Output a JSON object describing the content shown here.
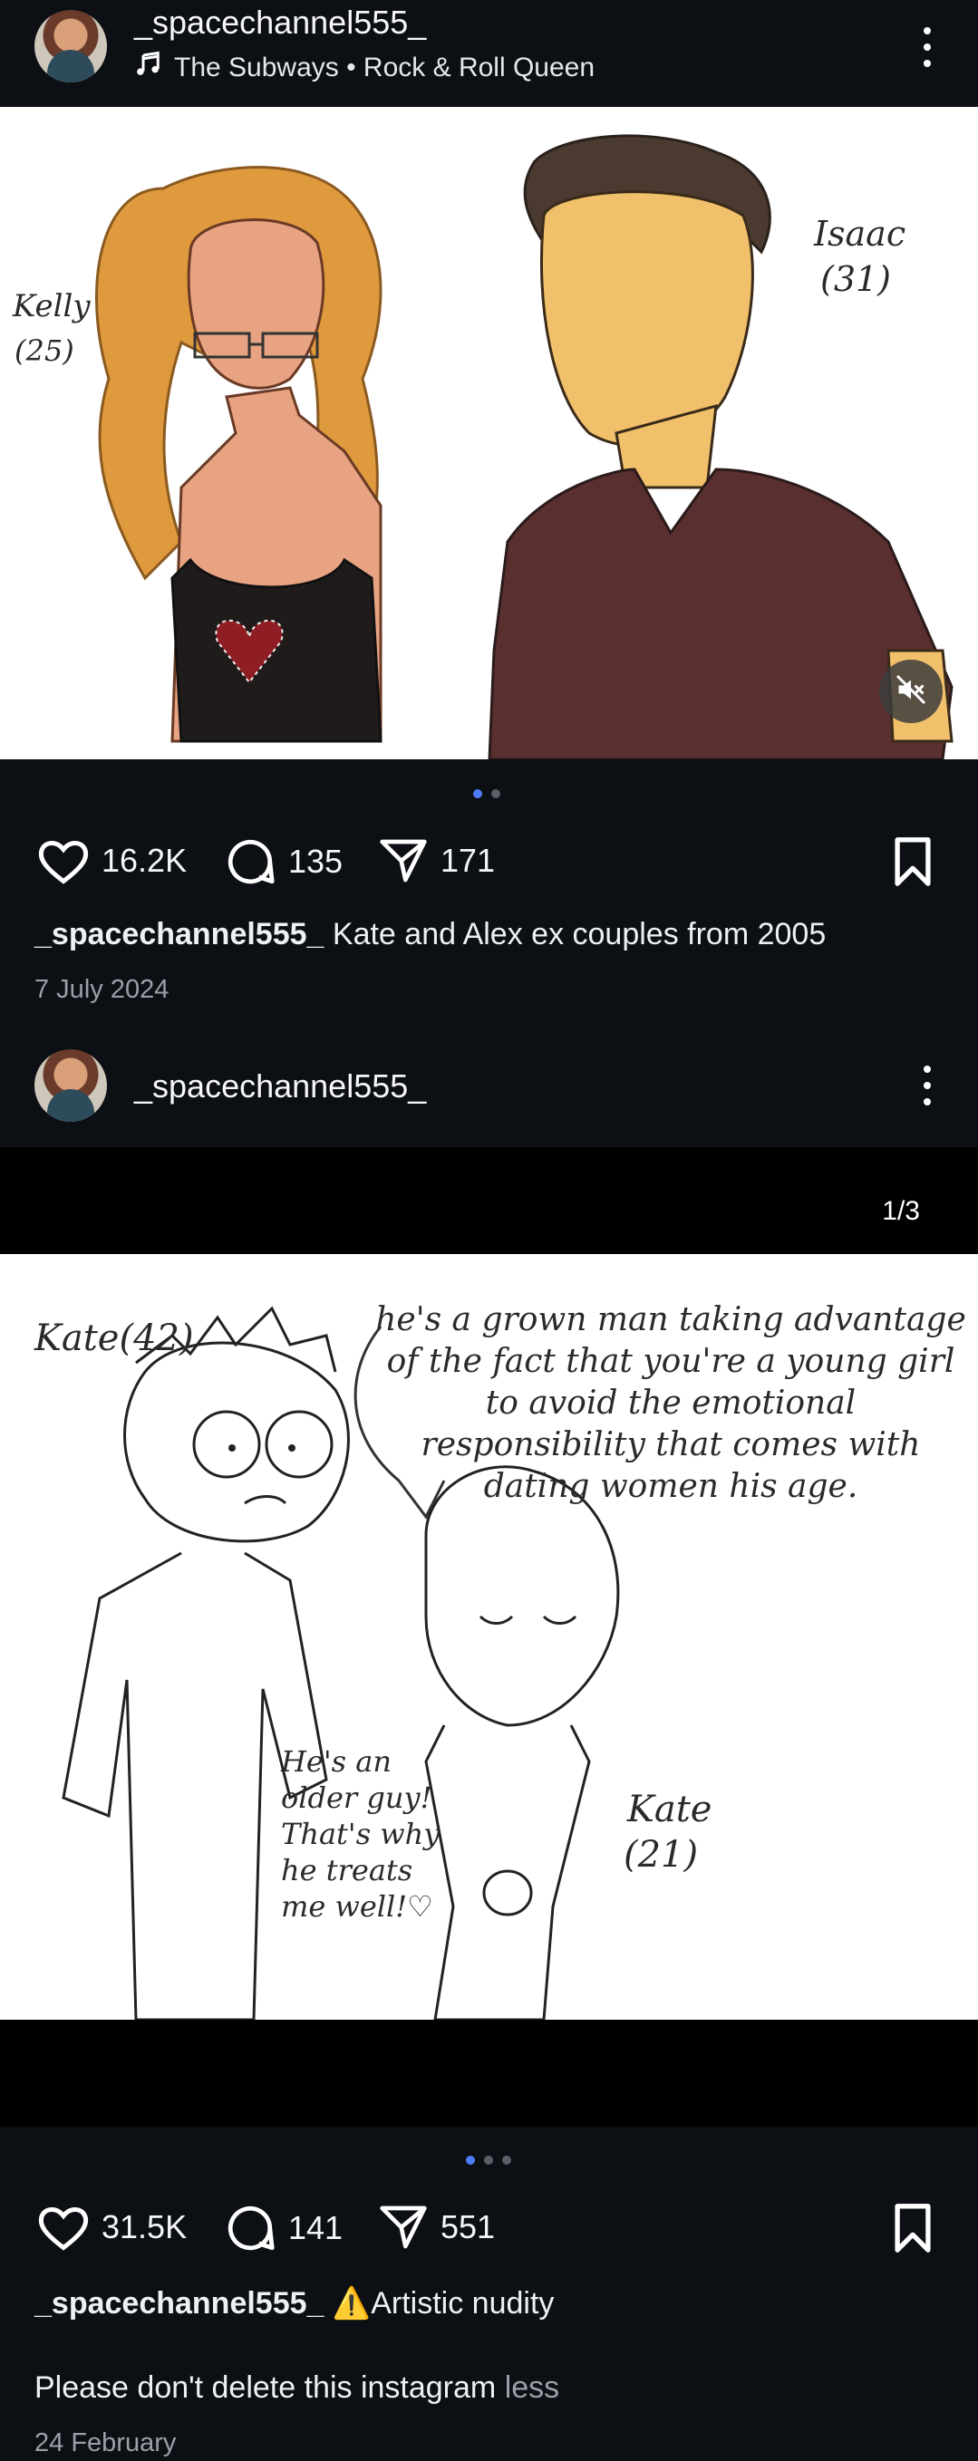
{
  "post1": {
    "username": "_spacechannel555_",
    "music": "The Subways • Rock & Roll Queen",
    "image_labels": {
      "left_name": "Kelly",
      "left_age": "(25)",
      "right_name": "Isaac",
      "right_age": "(31)"
    },
    "likes": "16.2K",
    "comments": "135",
    "shares": "171",
    "caption_user": "_spacechannel555_",
    "caption_text": "Kate and Alex ex couples from 2005",
    "date": "7 July 2024",
    "carousel_total": 2,
    "carousel_index": 1
  },
  "post2": {
    "username": "_spacechannel555_",
    "counter": "1/3",
    "image_labels": {
      "top_left": "Kate(42)",
      "speech_big": "he's a grown man taking advantage of the fact that you're a young girl to avoid the emotional responsibility that comes with dating women his age.",
      "speech_small": "He's an older guy! That's why he treats me well!♡",
      "right_name": "Kate",
      "right_age": "(21)"
    },
    "likes": "31.5K",
    "comments": "141",
    "shares": "551",
    "caption_user": "_spacechannel555_",
    "caption_warning": "⚠️Artistic nudity",
    "caption_body": "Please don't delete this instagram",
    "less_label": "less",
    "date": "24 February",
    "carousel_total": 3,
    "carousel_index": 1
  },
  "colors": {
    "background": "#0c0f14",
    "accent_dot": "#4f7df9",
    "muted_text": "#9aa0a8"
  },
  "icons": [
    "music-note-icon",
    "kebab-menu-icon",
    "heart-icon",
    "comment-icon",
    "share-icon",
    "bookmark-icon",
    "mute-icon",
    "warning-icon"
  ]
}
